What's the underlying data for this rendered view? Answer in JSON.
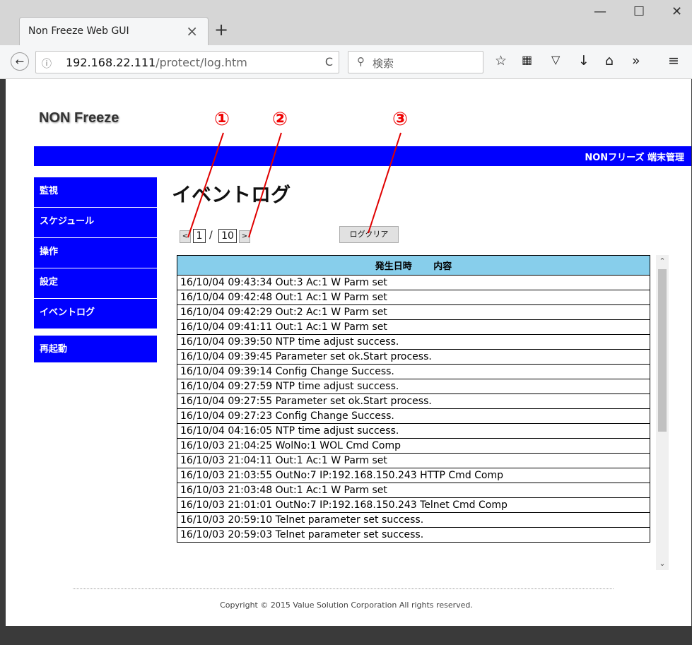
{
  "browser": {
    "tab_title": "Non Freeze Web GUI",
    "tab_close": "×",
    "new_tab": "+",
    "window_controls": {
      "minimize": "—",
      "maximize": "☐",
      "close": "✕"
    },
    "back_icon": "←",
    "info_icon": "ⓘ",
    "url_host": "192.168.22.111",
    "url_path": "/protect/log.htm",
    "reload_icon": "C",
    "search_placeholder": "検索",
    "search_icon": "🔍",
    "toolbar_icons": [
      "☆",
      "📖",
      "⛉",
      "⬇",
      "⌂",
      "»",
      "≡"
    ]
  },
  "page": {
    "logo": "NON Freeze",
    "banner": "NONフリーズ 端末管理",
    "sidebar": [
      {
        "label": "監視"
      },
      {
        "label": "スケジュール"
      },
      {
        "label": "操作"
      },
      {
        "label": "設定"
      },
      {
        "label": "イベントログ"
      },
      {
        "label": "再起動"
      }
    ],
    "heading": "イベントログ",
    "pager": {
      "prev": "<",
      "current": "1",
      "separator": "/",
      "total": "10",
      "next": ">"
    },
    "clear_button": "ログクリア",
    "log_header": "発生日時 　　内容",
    "logs": [
      "16/10/04 09:43:34 Out:3 Ac:1 W Parm set",
      "16/10/04 09:42:48 Out:1 Ac:1 W Parm set",
      "16/10/04 09:42:29 Out:2 Ac:1 W Parm set",
      "16/10/04 09:41:11 Out:1 Ac:1 W Parm set",
      "16/10/04 09:39:50 NTP time adjust success.",
      "16/10/04 09:39:45 Parameter set ok.Start process.",
      "16/10/04 09:39:14 Config Change Success.",
      "16/10/04 09:27:59 NTP time adjust success.",
      "16/10/04 09:27:55 Parameter set ok.Start process.",
      "16/10/04 09:27:23 Config Change Success.",
      "16/10/04 04:16:05 NTP time adjust success.",
      "16/10/03 21:04:25 WolNo:1 WOL Cmd Comp",
      "16/10/03 21:04:11 Out:1 Ac:1 W Parm set",
      "16/10/03 21:03:55 OutNo:7 IP:192.168.150.243 HTTP Cmd Comp",
      "16/10/03 21:03:48 Out:1 Ac:1 W Parm set",
      "16/10/03 21:01:01 OutNo:7 IP:192.168.150.243 Telnet Cmd Comp",
      "16/10/03 20:59:10 Telnet parameter set success.",
      "16/10/03 20:59:03 Telnet parameter set success."
    ],
    "copyright": "Copyright © 2015 Value Solution Corporation All rights reserved."
  },
  "annotations": {
    "mark1": "①",
    "mark2": "②",
    "mark3": "③",
    "color": "#e00000"
  }
}
